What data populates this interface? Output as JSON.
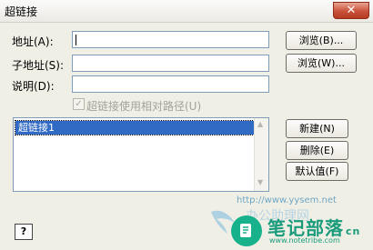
{
  "window": {
    "title": "超链接",
    "close_glyph": "✕"
  },
  "fields": {
    "address_label": "地址(A):",
    "address_value": "",
    "subaddress_label": "子地址(S):",
    "subaddress_value": "",
    "description_label": "说明(D):",
    "description_value": ""
  },
  "buttons": {
    "browse_address": "浏览(B)...",
    "browse_subaddress": "浏览(W)...",
    "new": "新建(N)",
    "delete": "删除(E)",
    "default": "默认值(F)",
    "help_glyph": "?"
  },
  "checkbox": {
    "label": "超链接使用相对路径(U)",
    "checked": true,
    "glyph": "✓"
  },
  "list": {
    "items": [
      "超链接1"
    ],
    "selected_index": 0,
    "arrow_up": "▲",
    "arrow_down": "▼"
  },
  "watermark": {
    "url": "http://www.yysem.net",
    "cn_faint": "办公助理网",
    "text": "笔记部落",
    "sub": "www.notetribe.com",
    "suffix": "cn"
  }
}
